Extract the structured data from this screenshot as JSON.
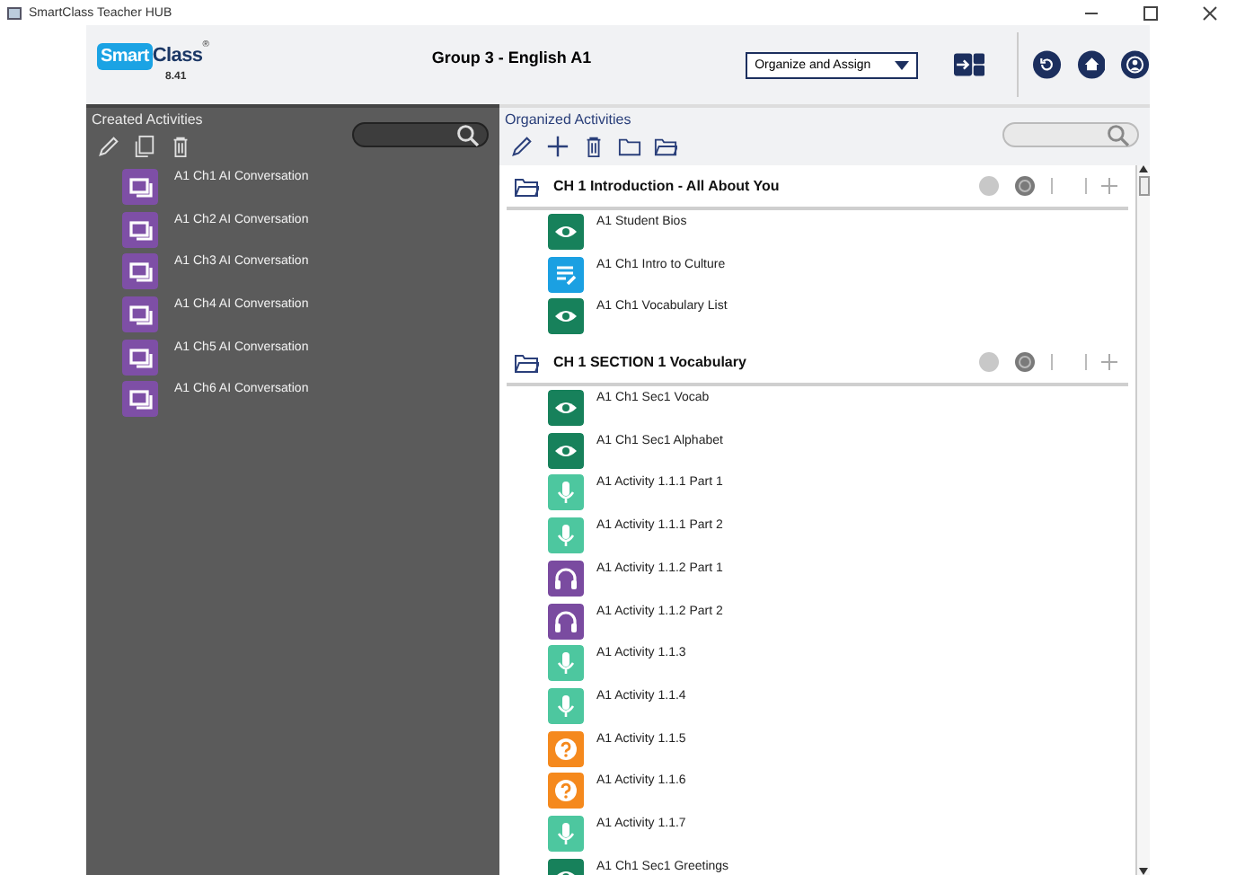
{
  "window": {
    "title": "SmartClass Teacher HUB"
  },
  "logo": {
    "brand_a": "Smart",
    "brand_b": "Class",
    "mark": "®",
    "version": "8.41"
  },
  "header": {
    "group": "Group 3 - English A1",
    "mode_select": "Organize and Assign"
  },
  "created": {
    "title": "Created Activities",
    "items": [
      {
        "label": "A1 Ch1 AI Conversation",
        "kind": "chat"
      },
      {
        "label": "A1 Ch2 AI Conversation",
        "kind": "chat"
      },
      {
        "label": "A1 Ch3 AI Conversation",
        "kind": "chat"
      },
      {
        "label": "A1 Ch4 AI Conversation",
        "kind": "chat"
      },
      {
        "label": "A1 Ch5 AI Conversation",
        "kind": "chat"
      },
      {
        "label": "A1 Ch6 AI Conversation",
        "kind": "chat"
      }
    ]
  },
  "organized": {
    "title": "Organized Activities",
    "sections": [
      {
        "title": "CH 1 Introduction - All About You",
        "items": [
          {
            "label": "A1 Student Bios",
            "kind": "view"
          },
          {
            "label": "A1 Ch1 Intro to Culture",
            "kind": "text"
          },
          {
            "label": "A1 Ch1 Vocabulary List",
            "kind": "view"
          }
        ]
      },
      {
        "title": "CH 1 SECTION 1 Vocabulary",
        "items": [
          {
            "label": "A1 Ch1 Sec1 Vocab",
            "kind": "view"
          },
          {
            "label": "A1 Ch1 Sec1 Alphabet",
            "kind": "view"
          },
          {
            "label": "A1 Activity 1.1.1 Part 1",
            "kind": "speak"
          },
          {
            "label": "A1 Activity 1.1.1 Part 2",
            "kind": "speak"
          },
          {
            "label": "A1 Activity 1.1.2 Part 1",
            "kind": "listen"
          },
          {
            "label": "A1 Activity 1.1.2 Part 2",
            "kind": "listen"
          },
          {
            "label": "A1 Activity 1.1.3",
            "kind": "speak"
          },
          {
            "label": "A1 Activity 1.1.4",
            "kind": "speak"
          },
          {
            "label": "A1 Activity 1.1.5",
            "kind": "quiz"
          },
          {
            "label": "A1 Activity 1.1.6",
            "kind": "quiz"
          },
          {
            "label": "A1 Activity 1.1.7",
            "kind": "speak"
          },
          {
            "label": "A1 Ch1 Sec1 Greetings",
            "kind": "view"
          }
        ]
      }
    ]
  }
}
